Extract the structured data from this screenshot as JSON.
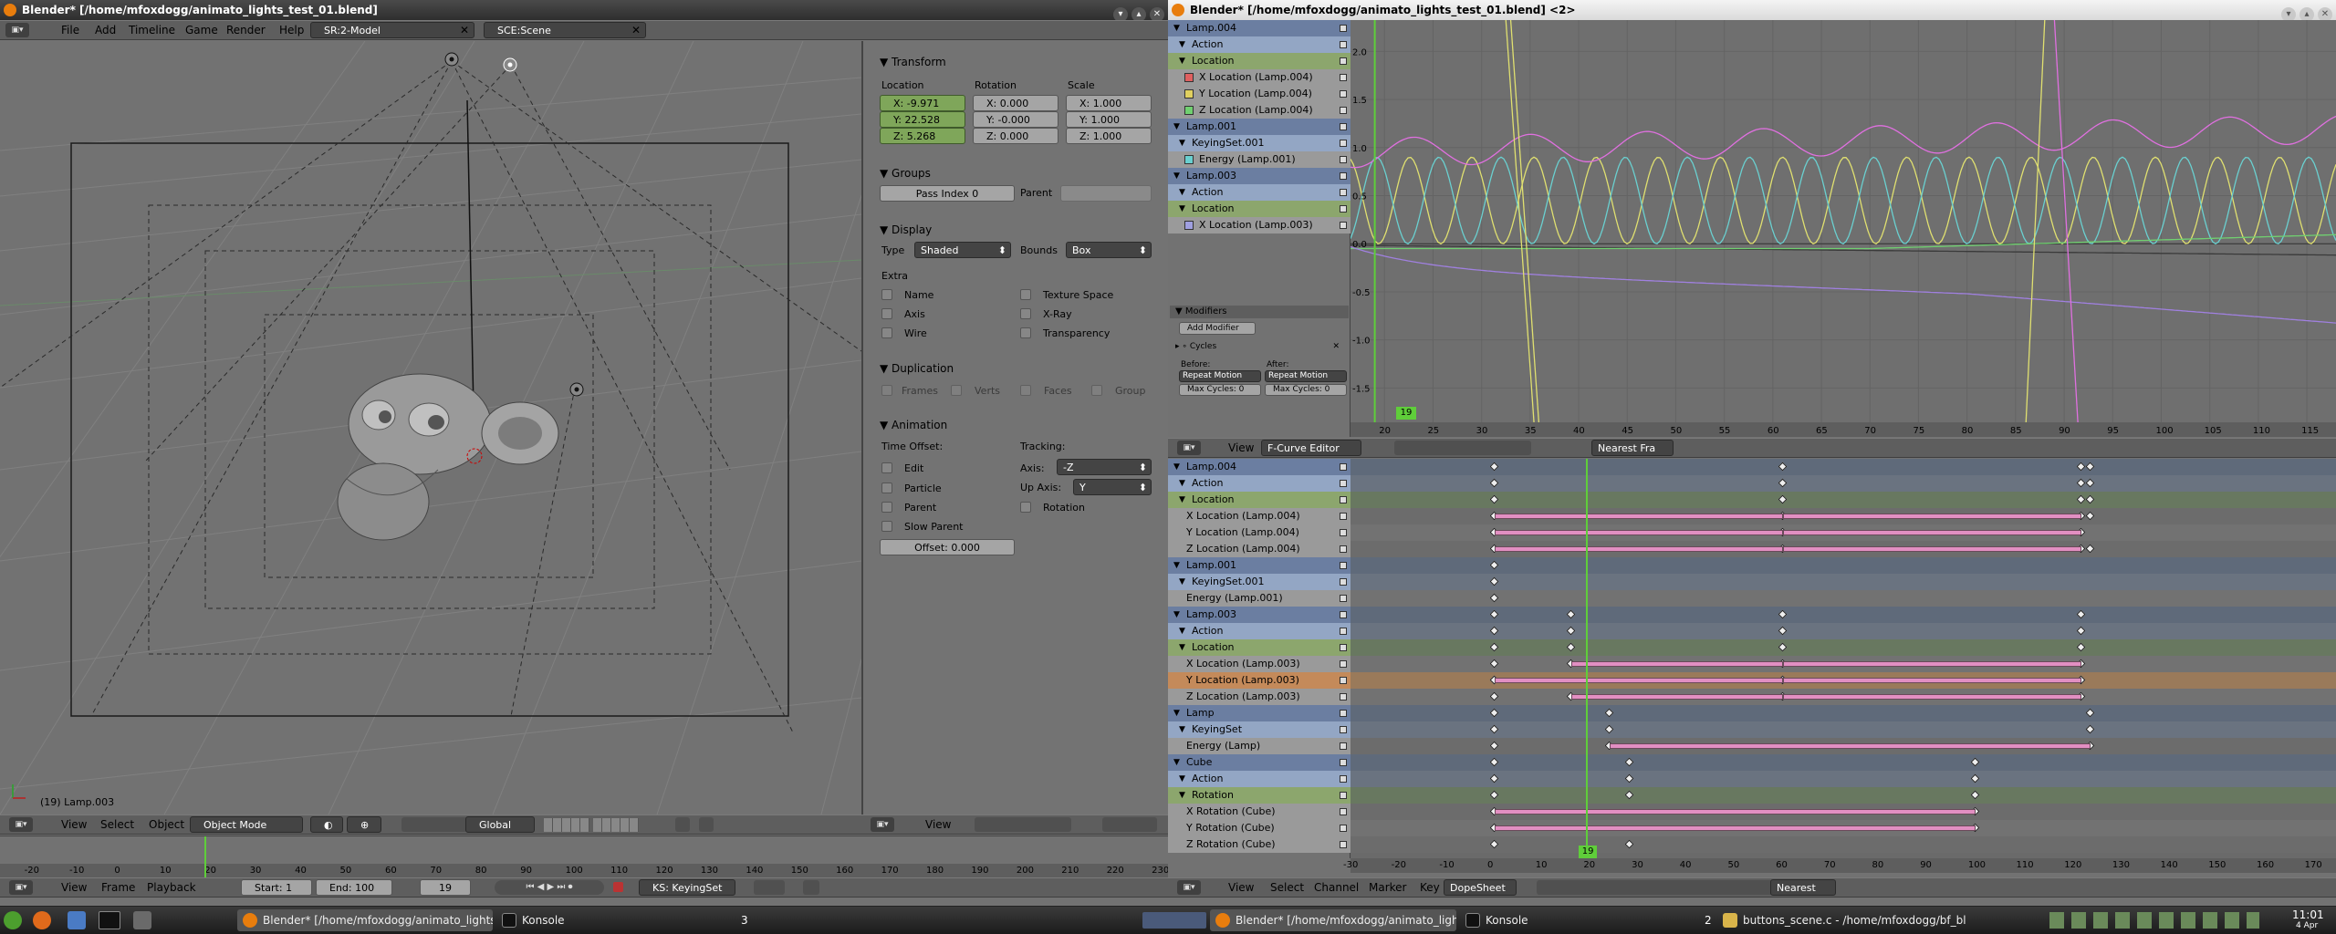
{
  "window_left": {
    "title": "Blender* [/home/mfoxdogg/animato_lights_test_01.blend]",
    "menu": [
      "File",
      "Add",
      "Timeline",
      "Game",
      "Render",
      "Help"
    ],
    "screen_field": "SR:2-Model",
    "scene_field": "SCE:Scene",
    "viewport": {
      "object_label": "(19) Lamp.003",
      "header": {
        "view": "View",
        "select": "Select",
        "object": "Object",
        "mode": "Object Mode",
        "orientation": "Global"
      }
    },
    "properties": {
      "transform": {
        "title": "Transform",
        "location_label": "Location",
        "rotation_label": "Rotation",
        "scale_label": "Scale",
        "location": [
          "X: -9.971",
          "Y: 22.528",
          "Z: 5.268"
        ],
        "rotation": [
          "X: 0.000",
          "Y: -0.000",
          "Z: 0.000"
        ],
        "scale": [
          "X: 1.000",
          "Y: 1.000",
          "Z: 1.000"
        ]
      },
      "groups": {
        "title": "Groups",
        "pass_index": "Pass Index 0",
        "parent_label": "Parent"
      },
      "display": {
        "title": "Display",
        "type_label": "Type",
        "type_value": "Shaded",
        "bounds_label": "Bounds",
        "bounds_value": "Box",
        "extra_label": "Extra",
        "options": [
          "Name",
          "Texture Space",
          "Axis",
          "X-Ray",
          "Wire",
          "Transparency"
        ]
      },
      "duplication": {
        "title": "Duplication",
        "options": [
          "Frames",
          "Verts",
          "Faces",
          "Group"
        ]
      },
      "animation": {
        "title": "Animation",
        "time_offset": "Time Offset:",
        "tracking": "Tracking:",
        "opts": [
          "Edit",
          "Particle",
          "Parent",
          "Slow Parent"
        ],
        "axis_label": "Axis:",
        "axis_value": "-Z",
        "upaxis_label": "Up Axis:",
        "upaxis_value": "Y",
        "rotation": "Rotation",
        "offset": "Offset: 0.000"
      },
      "footer_view": "View"
    },
    "timeline": {
      "ticks": [
        "-20",
        "-10",
        "0",
        "10",
        "20",
        "30",
        "40",
        "50",
        "60",
        "70",
        "80",
        "90",
        "100",
        "110",
        "120",
        "130",
        "140",
        "150",
        "160",
        "170",
        "180",
        "190",
        "200",
        "210",
        "220",
        "230"
      ],
      "view": "View",
      "frame": "Frame",
      "playback": "Playback",
      "start": "Start: 1",
      "end": "End: 100",
      "current": "19",
      "keyingset": "KS: KeyingSet"
    }
  },
  "window_right": {
    "title": "Blender* [/home/mfoxdogg/animato_lights_test_01.blend] <2>",
    "fcurve_channels": [
      {
        "label": "Lamp.004",
        "kind": "ob"
      },
      {
        "label": "Action",
        "kind": "act"
      },
      {
        "label": "Location",
        "kind": "grp"
      },
      {
        "label": "X Location (Lamp.004)",
        "kind": "ch",
        "color": "#e06060"
      },
      {
        "label": "Y Location (Lamp.004)",
        "kind": "ch",
        "color": "#e0d060"
      },
      {
        "label": "Z Location (Lamp.004)",
        "kind": "ch",
        "color": "#70d070"
      },
      {
        "label": "Lamp.001",
        "kind": "ob"
      },
      {
        "label": "KeyingSet.001",
        "kind": "act"
      },
      {
        "label": "Energy (Lamp.001)",
        "kind": "ch",
        "color": "#6ad0d0"
      },
      {
        "label": "Lamp.003",
        "kind": "ob"
      },
      {
        "label": "Action",
        "kind": "act"
      },
      {
        "label": "Location",
        "kind": "grp"
      },
      {
        "label": "X Location (Lamp.003)",
        "kind": "ch",
        "color": "#a0a0e0"
      }
    ],
    "modifiers": {
      "title": "Modifiers",
      "add": "Add Modifier",
      "cycles": "Cycles",
      "before": "Before:",
      "after": "After:",
      "before_mode": "Repeat Motion",
      "after_mode": "Repeat Motion",
      "before_max": "Max Cycles: 0",
      "after_max": "Max Cycles: 0"
    },
    "graph": {
      "y_ticks": [
        "2.0",
        "1.5",
        "1.0",
        "0.5",
        "0.0",
        "-0.5",
        "-1.0",
        "-1.5"
      ],
      "x_ticks": [
        "20",
        "25",
        "30",
        "35",
        "40",
        "45",
        "50",
        "55",
        "60",
        "65",
        "70",
        "75",
        "80",
        "85",
        "90",
        "95",
        "100",
        "105",
        "110",
        "115"
      ],
      "current_frame": "19"
    },
    "fcurve_header": {
      "view": "View",
      "editor": "F-Curve Editor",
      "snap": "Nearest Fra"
    },
    "dopesheet_channels": [
      {
        "label": "Lamp.004",
        "kind": "ob"
      },
      {
        "label": "Action",
        "kind": "act"
      },
      {
        "label": "Location",
        "kind": "grp"
      },
      {
        "label": "X Location (Lamp.004)",
        "kind": "ch"
      },
      {
        "label": "Y Location (Lamp.004)",
        "kind": "ch"
      },
      {
        "label": "Z Location (Lamp.004)",
        "kind": "ch"
      },
      {
        "label": "Lamp.001",
        "kind": "ob"
      },
      {
        "label": "KeyingSet.001",
        "kind": "act"
      },
      {
        "label": "Energy (Lamp.001)",
        "kind": "ch"
      },
      {
        "label": "Lamp.003",
        "kind": "ob"
      },
      {
        "label": "Action",
        "kind": "act"
      },
      {
        "label": "Location",
        "kind": "grp"
      },
      {
        "label": "X Location (Lamp.003)",
        "kind": "ch"
      },
      {
        "label": "Y Location (Lamp.003)",
        "kind": "ch",
        "selected": true
      },
      {
        "label": "Z Location (Lamp.003)",
        "kind": "ch"
      },
      {
        "label": "Lamp",
        "kind": "ob"
      },
      {
        "label": "KeyingSet",
        "kind": "act"
      },
      {
        "label": "Energy (Lamp)",
        "kind": "ch"
      },
      {
        "label": "Cube",
        "kind": "ob"
      },
      {
        "label": "Action",
        "kind": "act"
      },
      {
        "label": "Rotation",
        "kind": "grp"
      },
      {
        "label": "X Rotation (Cube)",
        "kind": "ch"
      },
      {
        "label": "Y Rotation (Cube)",
        "kind": "ch"
      },
      {
        "label": "Z Rotation (Cube)",
        "kind": "ch"
      }
    ],
    "dopesheet": {
      "x_ticks": [
        "-30",
        "-20",
        "-10",
        "0",
        "10",
        "20",
        "30",
        "40",
        "50",
        "60",
        "70",
        "80",
        "90",
        "100",
        "110",
        "120",
        "130",
        "140",
        "150",
        "160",
        "170"
      ],
      "current_frame": "19",
      "keys": [
        [
          0,
          "0,60,122,124"
        ],
        [
          1,
          "0,60,122,124"
        ],
        [
          2,
          "0,60,122,124"
        ],
        [
          3,
          "0,60,122,124"
        ],
        [
          4,
          "0,60,122"
        ],
        [
          5,
          "0,60,122,124"
        ],
        [
          6,
          "0"
        ],
        [
          7,
          "0"
        ],
        [
          8,
          "0"
        ],
        [
          9,
          "0,16,60,122"
        ],
        [
          10,
          "0,16,60,122"
        ],
        [
          11,
          "0,16,60,122"
        ],
        [
          12,
          "0,16,60,122"
        ],
        [
          13,
          "0,60,122"
        ],
        [
          14,
          "0,16,60,122"
        ],
        [
          15,
          "0,24,124"
        ],
        [
          16,
          "0,24,124"
        ],
        [
          17,
          "0,24,124"
        ],
        [
          18,
          "0,28,100"
        ],
        [
          19,
          "0,28,100"
        ],
        [
          20,
          "0,28,100"
        ],
        [
          21,
          "0,100"
        ],
        [
          22,
          "0,100"
        ],
        [
          23,
          "0,28"
        ]
      ]
    },
    "dopesheet_header": {
      "view": "View",
      "select": "Select",
      "channel": "Channel",
      "marker": "Marker",
      "key": "Key",
      "mode": "DopeSheet",
      "snap": "Nearest"
    }
  },
  "taskbar": {
    "left_tasks": [
      "Blender* [/home/mfoxdogg/animato_lights",
      "Konsole"
    ],
    "left_desktop": "3",
    "right_tasks": [
      "Blender* [/home/mfoxdogg/animato_lights",
      "Konsole"
    ],
    "right_desktop": "2",
    "right_editor": "buttons_scene.c - /home/mfoxdogg/bf_bl",
    "clock": "11:01",
    "date": "4 Apr"
  }
}
